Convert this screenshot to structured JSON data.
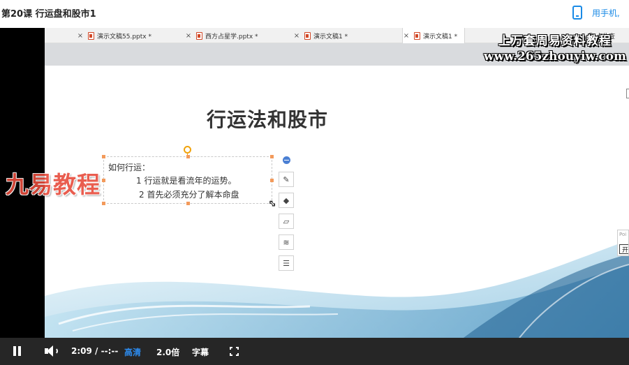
{
  "page": {
    "course_title": "第20课 行运盘和股市1",
    "phone_link": "用手机,"
  },
  "wps": {
    "tabs": [
      {
        "label": "演示文稿55.pptx *",
        "active": false
      },
      {
        "label": "西方占星学.pptx *",
        "active": false
      },
      {
        "label": "演示文稿1 *",
        "active": false
      },
      {
        "label": "演示文稿1 *",
        "active": true
      }
    ],
    "search_hint": "点此查"
  },
  "slide": {
    "title": "行运法和股市",
    "lines": [
      "如何行运：",
      "1 行运就是看流年的运势。",
      "2 首先必须充分了解本命盘"
    ],
    "side_popup_text": "Poi",
    "side_popup_button": "开"
  },
  "watermarks": {
    "site_title": "上万套周易资料教程",
    "site_url": "www.265zhouyiw.com",
    "brand": "九易教程"
  },
  "player": {
    "current_time": "2:09",
    "duration": "--:--",
    "quality": "高清",
    "speed": "2.0倍",
    "subtitles": "字幕",
    "state": "playing",
    "accent_color": "#2d8cf0"
  },
  "icons": [
    "phone-icon",
    "close-icon",
    "ppt-file-icon",
    "search-icon",
    "minus-circle-icon",
    "edit-shape-icon",
    "fill-bucket-icon",
    "outline-icon",
    "layers-icon",
    "text-wrap-icon",
    "rotate-handle-icon",
    "resize-cursor-icon",
    "pause-icon",
    "volume-icon",
    "fullscreen-icon"
  ]
}
